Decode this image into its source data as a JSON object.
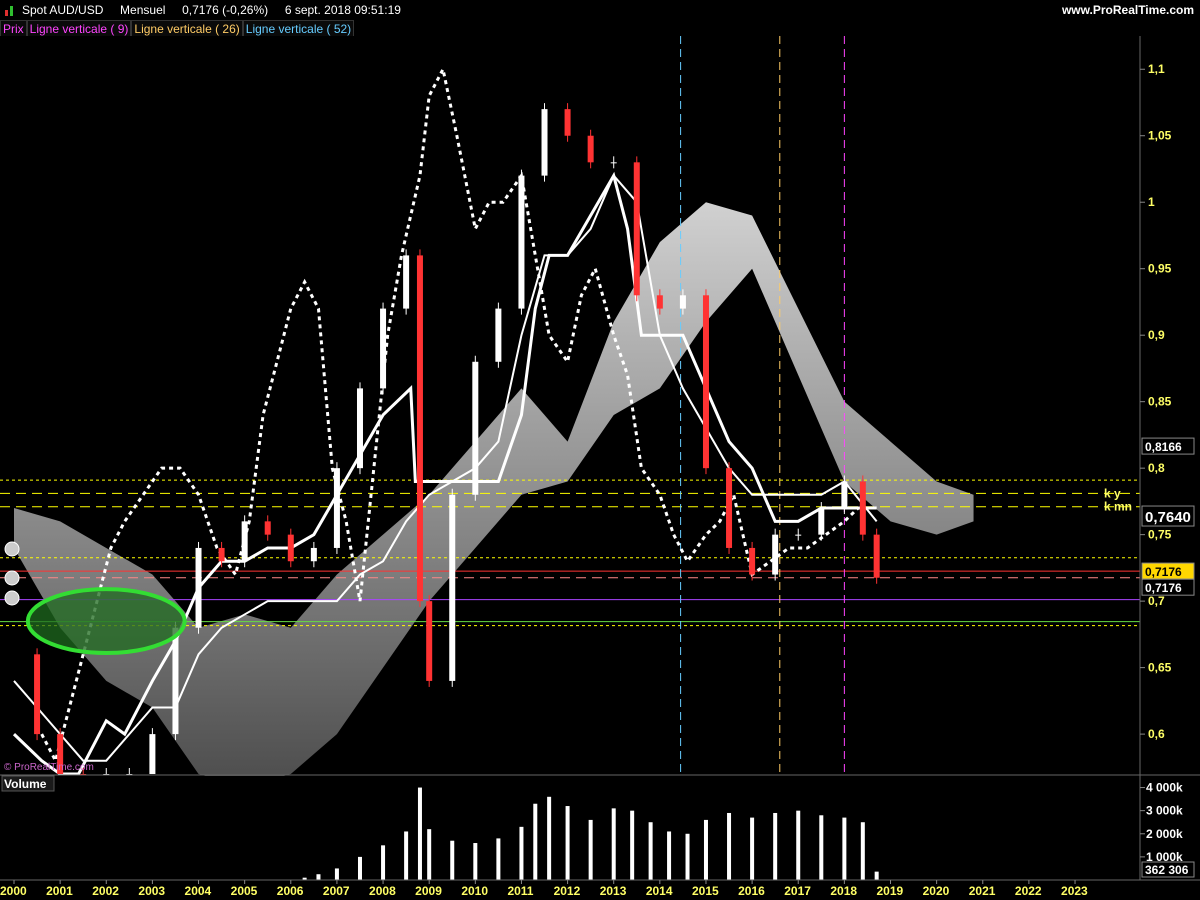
{
  "header": {
    "instrument": "Spot AUD/USD",
    "period": "Mensuel",
    "last": "0,7176 (-0,26%)",
    "datetime": "6 sept. 2018 09:51:19",
    "site": "www.ProRealTime.com"
  },
  "legend": [
    {
      "label": "Prix",
      "color": "#ff44ff"
    },
    {
      "label": "Ligne verticale ( 9)",
      "color": "#ff44ff"
    },
    {
      "label": "Ligne verticale ( 26)",
      "color": "#ffcc66"
    },
    {
      "label": "Ligne verticale ( 52)",
      "color": "#66ccff"
    }
  ],
  "watermark": "© ProRealTime.com",
  "volume_panel": {
    "title": "Volume"
  },
  "price_axis": {
    "min": 0.57,
    "max": 1.125,
    "ticks": [
      "1,1",
      "1,05",
      "1",
      "0,95",
      "0,9",
      "0,85",
      "0,8",
      "0,75",
      "0,7",
      "0,65",
      "0,6"
    ],
    "tick_values": [
      1.1,
      1.05,
      1.0,
      0.95,
      0.9,
      0.85,
      0.8,
      0.75,
      0.7,
      0.65,
      0.6
    ],
    "badges": [
      {
        "text": "0,8166",
        "value": 0.8166,
        "bg": "#000000",
        "fg": "#ffffff"
      },
      {
        "text": "0,7640",
        "value": 0.764,
        "bg": "#000000",
        "fg": "#ffffff"
      },
      {
        "text": "0,7176",
        "value": 0.7226,
        "bg": "#ffd700",
        "fg": "#000000"
      },
      {
        "text": "0,7176",
        "value": 0.7105,
        "bg": "#000000",
        "fg": "#ffffff"
      }
    ],
    "line_labels": [
      {
        "text": "k y",
        "value": 0.781
      },
      {
        "text": "k mn",
        "value": 0.771
      }
    ]
  },
  "volume_axis": {
    "ticks": [
      "4 000k",
      "3 000k",
      "2 000k",
      "1 000k"
    ],
    "tick_values": [
      4000,
      3000,
      2000,
      1000
    ],
    "badge": "362 306"
  },
  "time_axis": {
    "labels": [
      "2000",
      "2001",
      "2002",
      "2003",
      "2004",
      "2005",
      "2006",
      "2007",
      "2008",
      "2009",
      "2010",
      "2011",
      "2012",
      "2013",
      "2014",
      "2015",
      "2016",
      "2017",
      "2018",
      "2019",
      "2020",
      "2021",
      "2022",
      "2023"
    ],
    "start": 2000,
    "end": 2024.3
  },
  "chart_data": {
    "type": "line",
    "title": "Spot AUD/USD",
    "xlabel": "",
    "ylabel": "",
    "ylim": [
      0.57,
      1.125
    ],
    "volume_ylim": [
      0,
      4500
    ],
    "horizontal_lines": [
      {
        "value": 0.791,
        "color": "#ffff00",
        "style": "dotted"
      },
      {
        "value": 0.781,
        "color": "#ffff00",
        "style": "dashed"
      },
      {
        "value": 0.771,
        "color": "#ffff00",
        "style": "dashed"
      },
      {
        "value": 0.7326,
        "color": "#ffff00",
        "style": "dotted"
      },
      {
        "value": 0.7226,
        "color": "#ff3333",
        "style": "solid"
      },
      {
        "value": 0.7176,
        "color": "#ff8888",
        "style": "dashed"
      },
      {
        "value": 0.7011,
        "color": "#aa44ff",
        "style": "solid"
      },
      {
        "value": 0.6846,
        "color": "#66dd44",
        "style": "solid"
      },
      {
        "value": 0.6816,
        "color": "#ffff00",
        "style": "dotted"
      }
    ],
    "vertical_lines": [
      {
        "label": "Ligne verticale ( 52)",
        "x": 2014.45,
        "color": "#66ccff"
      },
      {
        "label": "Ligne verticale ( 26)",
        "x": 2016.6,
        "color": "#ffcc66"
      },
      {
        "label": "Ligne verticale ( 9)",
        "x": 2018.0,
        "color": "#ff44ff"
      }
    ],
    "highlight_ellipse": {
      "x": 2002.0,
      "y": 0.685,
      "rx_years": 1.7,
      "ry": 0.024,
      "color": "#22cc22"
    },
    "series": [
      {
        "name": "Prix",
        "style": "candles",
        "x": [
          2000.0,
          2000.5,
          2001.0,
          2001.5,
          2002.0,
          2002.5,
          2003.0,
          2003.5,
          2004.0,
          2004.5,
          2005.0,
          2005.5,
          2006.0,
          2006.5,
          2007.0,
          2007.5,
          2008.0,
          2008.5,
          2008.8,
          2009.0,
          2009.5,
          2010.0,
          2010.5,
          2011.0,
          2011.5,
          2012.0,
          2012.5,
          2013.0,
          2013.5,
          2014.0,
          2014.5,
          2015.0,
          2015.5,
          2016.0,
          2016.5,
          2017.0,
          2017.5,
          2018.0,
          2018.4,
          2018.7
        ],
        "y": [
          0.66,
          0.6,
          0.52,
          0.51,
          0.54,
          0.56,
          0.6,
          0.68,
          0.74,
          0.73,
          0.76,
          0.75,
          0.73,
          0.74,
          0.8,
          0.86,
          0.92,
          0.96,
          0.7,
          0.64,
          0.78,
          0.88,
          0.92,
          1.02,
          1.07,
          1.05,
          1.03,
          1.03,
          0.93,
          0.92,
          0.93,
          0.8,
          0.74,
          0.72,
          0.75,
          0.75,
          0.77,
          0.79,
          0.75,
          0.7176
        ]
      },
      {
        "name": "",
        "style": "white-solid-step",
        "x": [
          2000.0,
          2000.6,
          2001.0,
          2001.4,
          2002.0,
          2002.4,
          2003.0,
          2003.5,
          2004.0,
          2004.5,
          2005.0,
          2005.5,
          2006.0,
          2006.5,
          2007.0,
          2007.5,
          2008.0,
          2008.6,
          2008.7,
          2009.0,
          2009.5,
          2010.0,
          2010.5,
          2011.0,
          2011.3,
          2011.6,
          2012.0,
          2012.5,
          2013.0,
          2013.3,
          2013.6,
          2014.0,
          2014.5,
          2015.0,
          2015.5,
          2016.0,
          2016.5,
          2017.0,
          2017.5,
          2018.0,
          2018.7
        ],
        "y": [
          0.6,
          0.58,
          0.55,
          0.55,
          0.61,
          0.6,
          0.64,
          0.67,
          0.71,
          0.73,
          0.73,
          0.74,
          0.74,
          0.75,
          0.78,
          0.81,
          0.84,
          0.86,
          0.79,
          0.79,
          0.79,
          0.79,
          0.79,
          0.84,
          0.92,
          0.96,
          0.96,
          0.99,
          1.02,
          0.98,
          0.9,
          0.9,
          0.9,
          0.86,
          0.82,
          0.8,
          0.76,
          0.76,
          0.77,
          0.77,
          0.77
        ]
      },
      {
        "name": "",
        "style": "white-solid-lagging",
        "x": [
          2000.0,
          2000.5,
          2001.0,
          2001.5,
          2002.0,
          2002.5,
          2003.0,
          2003.5,
          2004.0,
          2004.5,
          2005.0,
          2005.5,
          2006.0,
          2006.5,
          2007.0,
          2007.5,
          2008.0,
          2008.5,
          2009.0,
          2009.5,
          2010.0,
          2010.5,
          2011.0,
          2011.5,
          2012.0,
          2012.5,
          2013.0,
          2013.5,
          2014.0,
          2014.5,
          2015.0,
          2015.5,
          2016.0,
          2016.5,
          2017.0,
          2017.5,
          2018.0,
          2018.7
        ],
        "y": [
          0.64,
          0.62,
          0.6,
          0.58,
          0.58,
          0.6,
          0.62,
          0.62,
          0.66,
          0.68,
          0.69,
          0.7,
          0.7,
          0.7,
          0.7,
          0.72,
          0.73,
          0.76,
          0.78,
          0.79,
          0.8,
          0.82,
          0.9,
          0.96,
          0.96,
          0.98,
          1.02,
          1.0,
          0.9,
          0.86,
          0.83,
          0.8,
          0.78,
          0.78,
          0.78,
          0.78,
          0.79,
          0.76
        ]
      },
      {
        "name": "",
        "style": "white-dashed",
        "x": [
          2000.6,
          2000.9,
          2001.2,
          2001.5,
          2001.8,
          2002.1,
          2002.4,
          2002.8,
          2003.2,
          2003.6,
          2004.0,
          2004.4,
          2004.8,
          2005.1,
          2005.4,
          2005.7,
          2006.0,
          2006.3,
          2006.6,
          2006.9,
          2007.2,
          2007.5,
          2007.8,
          2008.1,
          2008.4,
          2008.8,
          2009.0,
          2009.3,
          2009.6,
          2010.0,
          2010.3,
          2010.6,
          2011.0,
          2011.3,
          2011.6,
          2012.0,
          2012.3,
          2012.6,
          2013.0,
          2013.3,
          2013.6,
          2014.0,
          2014.3,
          2014.6,
          2015.0,
          2015.3,
          2015.6,
          2016.0,
          2016.4,
          2016.8,
          2017.2,
          2017.6,
          2018.0,
          2018.3
        ],
        "y": [
          0.6,
          0.58,
          0.62,
          0.66,
          0.7,
          0.74,
          0.76,
          0.78,
          0.8,
          0.8,
          0.78,
          0.74,
          0.72,
          0.76,
          0.84,
          0.88,
          0.92,
          0.94,
          0.92,
          0.8,
          0.76,
          0.7,
          0.8,
          0.9,
          0.96,
          1.02,
          1.08,
          1.1,
          1.05,
          0.98,
          1.0,
          1.0,
          1.02,
          0.96,
          0.9,
          0.88,
          0.93,
          0.95,
          0.9,
          0.87,
          0.8,
          0.78,
          0.75,
          0.73,
          0.75,
          0.76,
          0.78,
          0.72,
          0.73,
          0.74,
          0.74,
          0.75,
          0.76,
          0.77
        ]
      }
    ],
    "cloud": {
      "x": [
        2000.0,
        2001.0,
        2002.0,
        2003.0,
        2004.0,
        2005.0,
        2006.0,
        2007.0,
        2008.0,
        2009.0,
        2010.0,
        2011.0,
        2012.0,
        2013.0,
        2014.0,
        2015.0,
        2016.0,
        2017.0,
        2018.0,
        2019.0,
        2020.0,
        2020.8
      ],
      "upper": [
        0.77,
        0.76,
        0.74,
        0.72,
        0.68,
        0.69,
        0.68,
        0.72,
        0.75,
        0.78,
        0.82,
        0.86,
        0.82,
        0.91,
        0.97,
        1.0,
        0.99,
        0.92,
        0.85,
        0.82,
        0.79,
        0.78
      ],
      "lower": [
        0.74,
        0.68,
        0.64,
        0.62,
        0.57,
        0.56,
        0.57,
        0.6,
        0.65,
        0.7,
        0.74,
        0.78,
        0.79,
        0.84,
        0.86,
        0.91,
        0.95,
        0.87,
        0.79,
        0.76,
        0.75,
        0.76
      ]
    },
    "volume": {
      "x": [
        2006.3,
        2006.6,
        2007.0,
        2007.5,
        2008.0,
        2008.5,
        2008.8,
        2009.0,
        2009.5,
        2010.0,
        2010.5,
        2011.0,
        2011.3,
        2011.6,
        2012.0,
        2012.5,
        2013.0,
        2013.4,
        2013.8,
        2014.2,
        2014.6,
        2015.0,
        2015.5,
        2016.0,
        2016.5,
        2017.0,
        2017.5,
        2018.0,
        2018.4,
        2018.7
      ],
      "values": [
        100,
        250,
        500,
        1000,
        1500,
        2100,
        4000,
        2200,
        1700,
        1600,
        1800,
        2300,
        3300,
        3600,
        3200,
        2600,
        3100,
        3000,
        2500,
        2100,
        2000,
        2600,
        2900,
        2700,
        2900,
        3000,
        2800,
        2700,
        2500,
        362
      ]
    }
  }
}
